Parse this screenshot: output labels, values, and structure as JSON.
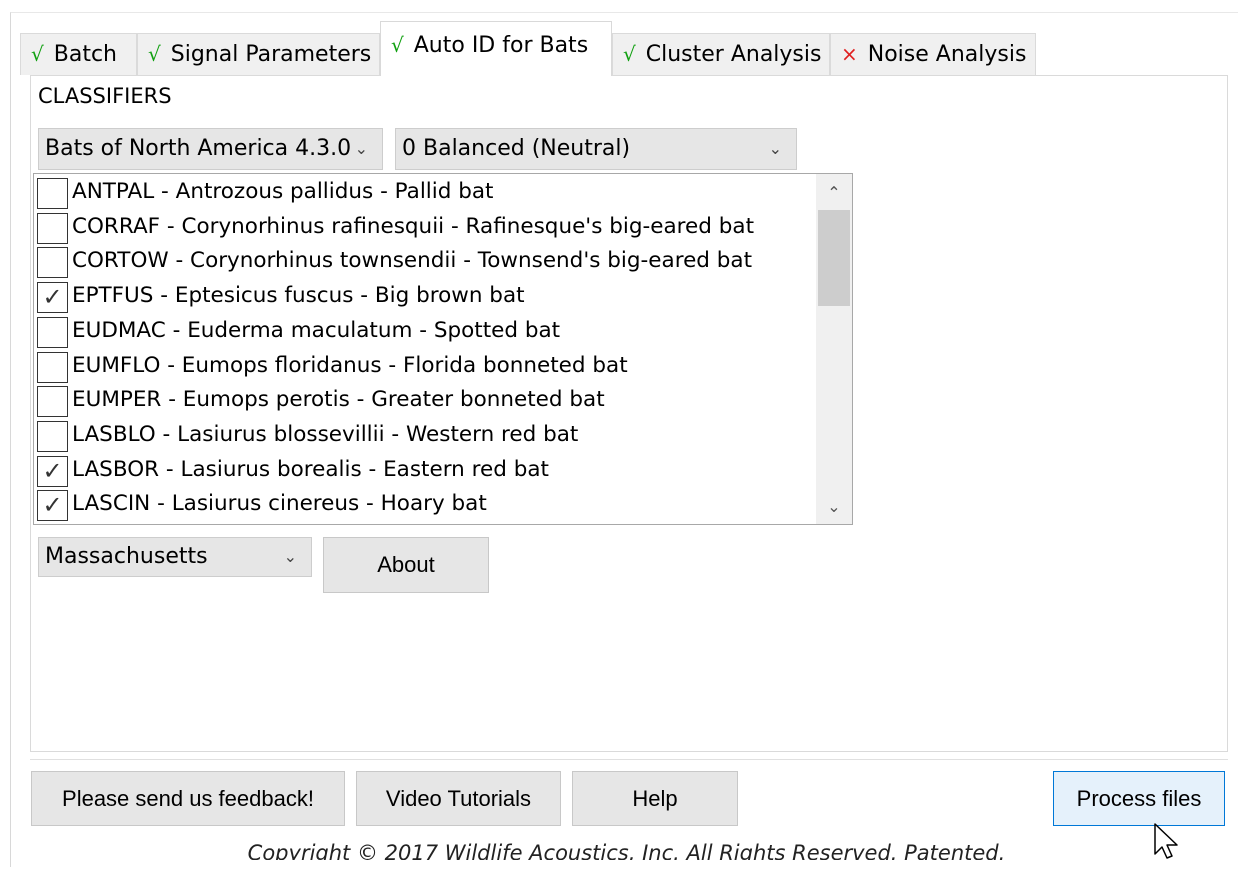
{
  "tabs": [
    {
      "label": "Batch",
      "status": "ok"
    },
    {
      "label": "Signal Parameters",
      "status": "ok"
    },
    {
      "label": "Auto ID for Bats",
      "status": "ok",
      "active": true
    },
    {
      "label": "Cluster Analysis",
      "status": "ok"
    },
    {
      "label": "Noise Analysis",
      "status": "error"
    }
  ],
  "status_marks": {
    "ok": "√",
    "error": "×"
  },
  "colors": {
    "ok": "#10a010",
    "error": "#e02020",
    "accent": "#0078d7"
  },
  "classifiers": {
    "group_label": "CLASSIFIERS",
    "classifier_select": "Bats of North America 4.3.0",
    "sensitivity_select": "0 Balanced (Neutral)",
    "species": [
      {
        "label": "ANTPAL - Antrozous pallidus - Pallid bat",
        "checked": false
      },
      {
        "label": "CORRAF - Corynorhinus rafinesquii - Rafinesque's big-eared bat",
        "checked": false
      },
      {
        "label": "CORTOW - Corynorhinus townsendii - Townsend's big-eared bat",
        "checked": false
      },
      {
        "label": "EPTFUS - Eptesicus fuscus - Big brown bat",
        "checked": true
      },
      {
        "label": "EUDMAC - Euderma maculatum - Spotted bat",
        "checked": false
      },
      {
        "label": "EUMFLO - Eumops floridanus - Florida bonneted bat",
        "checked": false
      },
      {
        "label": "EUMPER - Eumops perotis - Greater bonneted bat",
        "checked": false
      },
      {
        "label": "LASBLO - Lasiurus blossevillii - Western red bat",
        "checked": false
      },
      {
        "label": "LASBOR - Lasiurus borealis - Eastern red bat",
        "checked": true
      },
      {
        "label": "LASCIN - Lasiurus cinereus - Hoary bat",
        "checked": true
      }
    ],
    "region_select": "Massachusetts",
    "about_label": "About"
  },
  "footer": {
    "feedback_label": "Please send us feedback!",
    "tutorials_label": "Video Tutorials",
    "help_label": "Help",
    "process_label": "Process files",
    "copyright": "Copyright © 2017 Wildlife Acoustics, Inc. All Rights Reserved. Patented."
  }
}
